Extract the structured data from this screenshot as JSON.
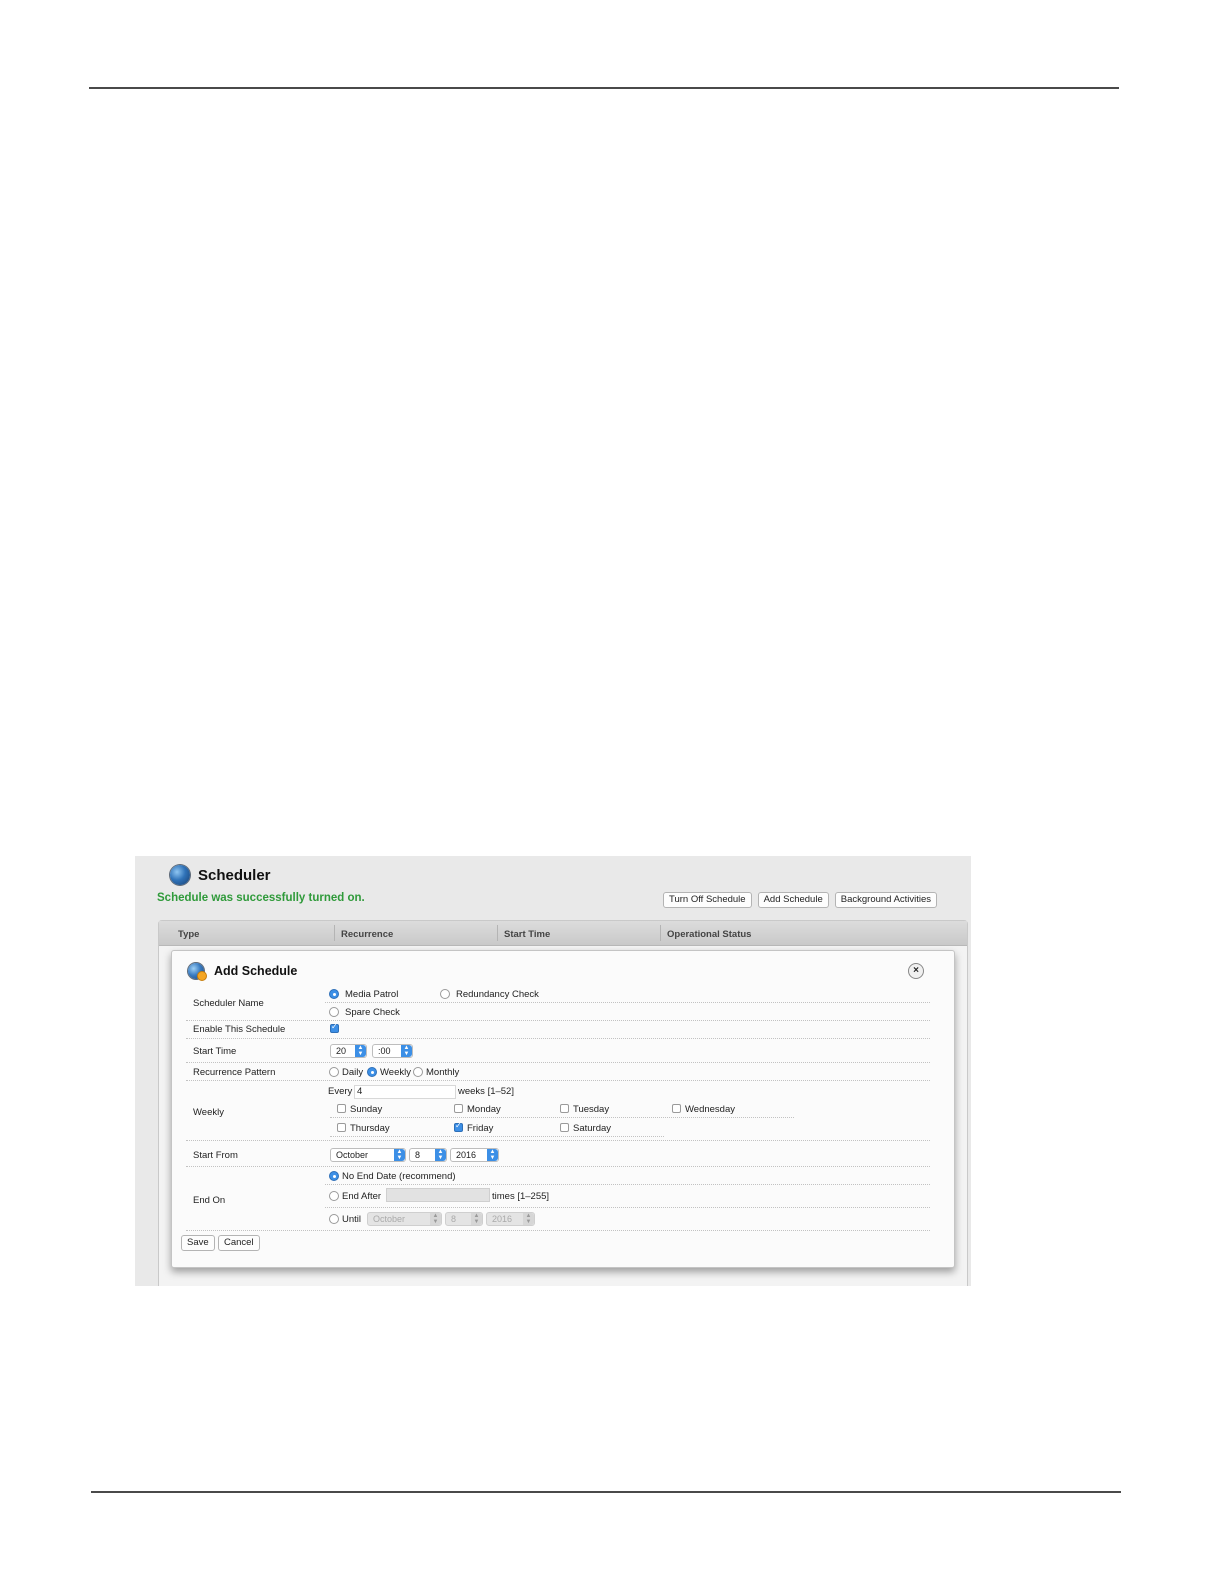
{
  "scheduler": {
    "title": "Scheduler",
    "status_message": "Schedule was successfully turned on.",
    "buttons": [
      "Turn Off Schedule",
      "Add Schedule",
      "Background Activities"
    ],
    "columns": [
      "Type",
      "Recurrence",
      "Start Time",
      "Operational Status"
    ]
  },
  "dialog": {
    "title": "Add Schedule",
    "close_symbol": "×",
    "scheduler_name": {
      "label": "Scheduler Name",
      "options": [
        "Media Patrol",
        "Redundancy Check",
        "Spare Check"
      ],
      "selected": "Media Patrol"
    },
    "enable": {
      "label": "Enable This Schedule",
      "checked": true
    },
    "start_time": {
      "label": "Start Time",
      "hour": "20",
      "minute": ":00"
    },
    "recurrence": {
      "label": "Recurrence Pattern",
      "options": [
        "Daily",
        "Weekly",
        "Monthly"
      ],
      "selected": "Weekly"
    },
    "weekly": {
      "label": "Weekly",
      "every_label": "Every",
      "every_value": "4",
      "range_text": "weeks [1–52]",
      "days": [
        "Sunday",
        "Monday",
        "Tuesday",
        "Wednesday",
        "Thursday",
        "Friday",
        "Saturday"
      ],
      "checked_day": "Friday"
    },
    "start_from": {
      "label": "Start From",
      "month": "October",
      "day": "8",
      "year": "2016"
    },
    "end_on": {
      "label": "End On",
      "options": [
        "No End Date (recommend)",
        "End After",
        "Until"
      ],
      "selected": "No End Date (recommend)",
      "times_text": "times [1–255]",
      "until_month": "October",
      "until_day": "8",
      "until_year": "2016"
    },
    "buttons": {
      "save": "Save",
      "cancel": "Cancel"
    }
  },
  "icons": {
    "scheduler": "globe-icon",
    "dialog": "globe-settings-icon",
    "close": "close-icon"
  },
  "colors": {
    "success": "#2f9a3a",
    "accent": "#3c8fe6"
  }
}
